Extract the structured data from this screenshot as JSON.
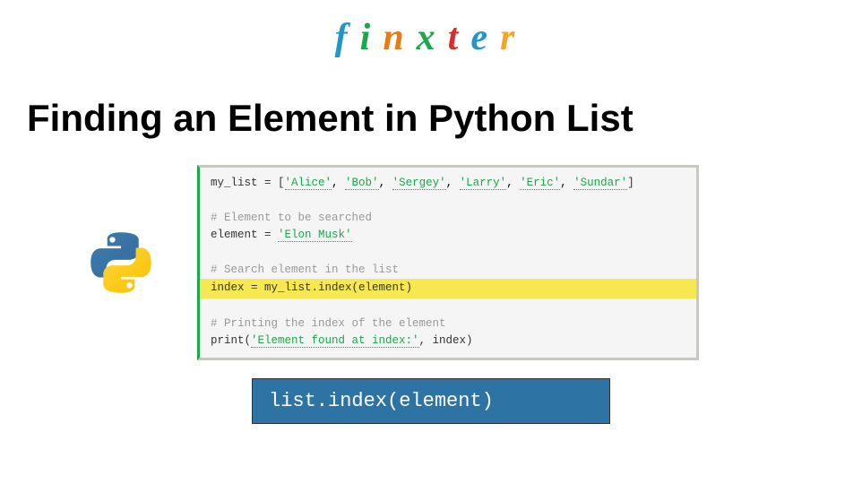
{
  "logo": {
    "letters": [
      "f",
      "i",
      "n",
      "x",
      "t",
      "e",
      "r"
    ]
  },
  "title": "Finding an Element in Python List",
  "code": {
    "line1_prefix": "my_list = [",
    "line1_items": [
      "'Alice'",
      "'Bob'",
      "'Sergey'",
      "'Larry'",
      "'Eric'",
      "'Sundar'"
    ],
    "line1_suffix": "]",
    "comment1": "# Element to be searched",
    "line2_prefix": "element = ",
    "line2_value": "'Elon Musk'",
    "comment2": "# Search element in the list",
    "line3": "index = my_list.index(element)",
    "comment3": "# Printing the index of the element",
    "line4_prefix": "print(",
    "line4_str": "'Element found at index:'",
    "line4_suffix": ", index)"
  },
  "method_box": "list.index(element)"
}
